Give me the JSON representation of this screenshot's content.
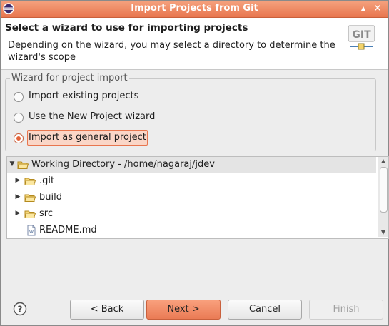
{
  "window": {
    "title": "Import Projects from Git"
  },
  "header": {
    "title": "Select a wizard to use for importing projects",
    "description": "Depending on the wizard, you may select a directory to determine the wizard's scope",
    "logo_text": "GIT"
  },
  "group": {
    "legend": "Wizard for project import",
    "options": [
      {
        "label": "Import existing projects",
        "checked": false
      },
      {
        "label": "Use the New Project wizard",
        "checked": false
      },
      {
        "label": "Import as general project",
        "checked": true
      }
    ]
  },
  "tree": {
    "root": "Working Directory - /home/nagaraj/jdev",
    "items": [
      {
        "label": ".git",
        "type": "folder"
      },
      {
        "label": "build",
        "type": "folder"
      },
      {
        "label": "src",
        "type": "folder"
      },
      {
        "label": "README.md",
        "type": "file"
      }
    ]
  },
  "buttons": {
    "back": "< Back",
    "next": "Next >",
    "cancel": "Cancel",
    "finish": "Finish"
  },
  "colors": {
    "accent": "#e8764f",
    "titlebar": "#ef8a61"
  }
}
